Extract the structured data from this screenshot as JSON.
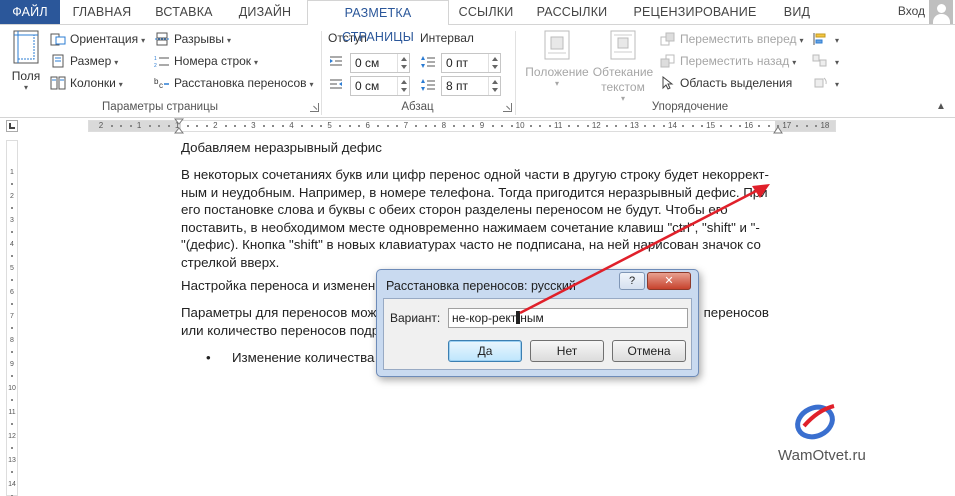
{
  "tabs": [
    {
      "label": "ФАЙЛ"
    },
    {
      "label": "ГЛАВНАЯ"
    },
    {
      "label": "ВСТАВКА"
    },
    {
      "label": "ДИЗАЙН"
    },
    {
      "label": "РАЗМЕТКА СТРАНИЦЫ"
    },
    {
      "label": "ССЫЛКИ"
    },
    {
      "label": "РАССЫЛКИ"
    },
    {
      "label": "РЕЦЕНЗИРОВАНИЕ"
    },
    {
      "label": "ВИД"
    }
  ],
  "user": {
    "signin_label": "Вход"
  },
  "ribbon": {
    "page_setup": {
      "fields_label": "Поля",
      "orientation_label": "Ориентация",
      "size_label": "Размер",
      "columns_label": "Колонки",
      "breaks_label": "Разрывы",
      "line_numbers_label": "Номера строк",
      "hyphenation_label": "Расстановка переносов",
      "group_label": "Параметры страницы"
    },
    "paragraph": {
      "indent_label": "Отступ",
      "spacing_label": "Интервал",
      "indent_left": "0 см",
      "indent_right": "0 см",
      "spacing_before": "0 пт",
      "spacing_after": "8 пт",
      "group_label": "Абзац"
    },
    "arrange": {
      "position_label": "Положение",
      "wrap_label": "Обтекание текстом",
      "bring_forward_label": "Переместить вперед",
      "send_backward_label": "Переместить назад",
      "selection_pane_label": "Область выделения",
      "group_label": "Упорядочение"
    }
  },
  "ruler": {
    "numbers": [
      "2",
      "1",
      "1",
      "2",
      "3",
      "4",
      "5",
      "6",
      "7",
      "8",
      "9",
      "10",
      "11",
      "12",
      "13",
      "14",
      "15",
      "16",
      "17",
      "18"
    ],
    "vnumbers": [
      "1",
      "2",
      "3",
      "4",
      "5",
      "6",
      "7",
      "8",
      "9",
      "10",
      "11",
      "12",
      "13",
      "14"
    ]
  },
  "document": {
    "heading1": "Добавляем неразрывный дефис",
    "para1_lines": [
      "В некоторых сочетаниях букв или цифр перенос одной части в другую строку будет некоррект-",
      "ным и неудобным. Например, в номере телефона. Тогда пригодится неразрывный дефис. При",
      "его постановке слова и буквы с обеих сторон разделены переносом не будут. Чтобы его",
      "поставить, в необходимом месте одновременно нажимаем сочетание клавиш \"ctrl\", \"shift\" и \"-",
      "\"(дефис). Кнопка \"shift\" в новых клавиатурах часто не подписана, на ней нарисован значок со",
      "стрелкой вверх."
    ],
    "heading2": "Настройка переноса и изменен",
    "para2_line1_left": "Параметры для переносов мож",
    "para2_line1_right": "переносов",
    "para2_line2": "или количество переносов подр",
    "bullet1": "Изменение количества"
  },
  "dialog": {
    "title": "Расстановка переносов: русский",
    "help_label": "?",
    "close_label": "✕",
    "variant_label": "Вариант:",
    "variant_value_before": "не-кор-рект",
    "variant_value_after": "ным",
    "yes_label": "Да",
    "no_label": "Нет",
    "cancel_label": "Отмена"
  },
  "watermark": {
    "text": "WamOtvet.ru"
  },
  "colors": {
    "file_tab": "#2b579a",
    "active_tab_text": "#2b579a",
    "arrow": "#e0202a",
    "dialog_frame": "#c9daf0"
  }
}
